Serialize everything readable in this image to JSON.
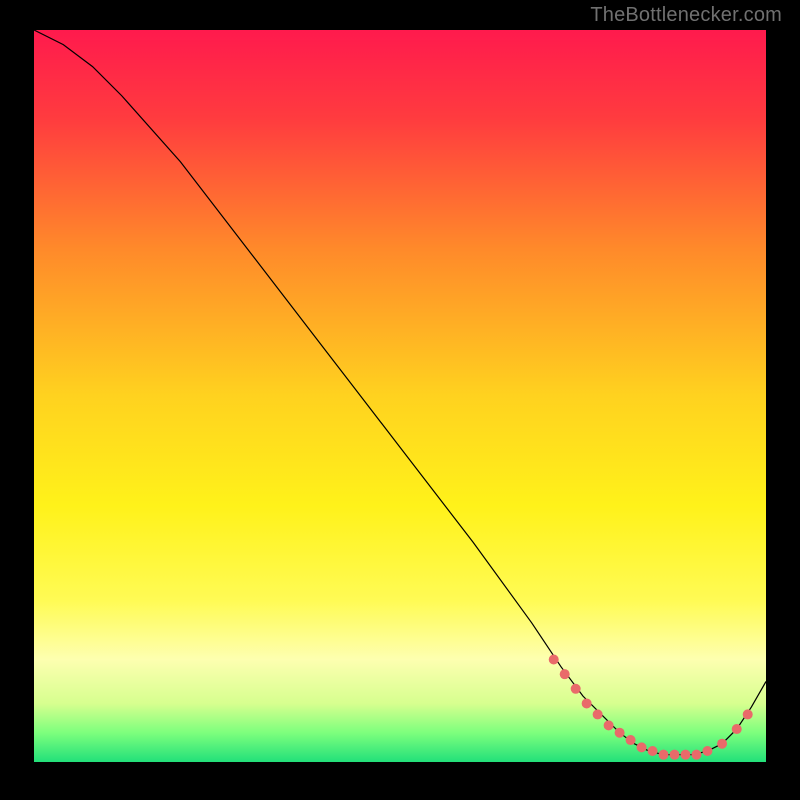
{
  "watermark": "TheBottlenecker.com",
  "chart_data": {
    "type": "line",
    "title": "",
    "xlabel": "",
    "ylabel": "",
    "xlim": [
      0,
      100
    ],
    "ylim": [
      0,
      100
    ],
    "grid": false,
    "background": {
      "type": "vertical-gradient",
      "stops": [
        {
          "pos": 0.0,
          "color": "#ff1a4d"
        },
        {
          "pos": 0.12,
          "color": "#ff3b3f"
        },
        {
          "pos": 0.3,
          "color": "#ff8a2a"
        },
        {
          "pos": 0.5,
          "color": "#ffd21f"
        },
        {
          "pos": 0.65,
          "color": "#fff21a"
        },
        {
          "pos": 0.78,
          "color": "#fffb55"
        },
        {
          "pos": 0.86,
          "color": "#fdffb0"
        },
        {
          "pos": 0.92,
          "color": "#d7ff8f"
        },
        {
          "pos": 0.96,
          "color": "#7dff7d"
        },
        {
          "pos": 1.0,
          "color": "#22e07a"
        }
      ]
    },
    "series": [
      {
        "name": "bottleneck-curve",
        "color": "#000000",
        "width": 1.2,
        "x": [
          0,
          4,
          8,
          12,
          20,
          30,
          40,
          50,
          60,
          68,
          72,
          75,
          78,
          80,
          82,
          84,
          86,
          88,
          90,
          92,
          94,
          96,
          98,
          100
        ],
        "y": [
          100,
          98,
          95,
          91,
          82,
          69,
          56,
          43,
          30,
          19,
          13,
          9,
          6,
          4,
          2.5,
          1.5,
          1,
          1,
          1,
          1.5,
          2.5,
          4.5,
          7.5,
          11
        ]
      }
    ],
    "markers": {
      "name": "highlight-dots",
      "color": "#e96a6a",
      "radius": 5,
      "points": [
        {
          "x": 71,
          "y": 14
        },
        {
          "x": 72.5,
          "y": 12
        },
        {
          "x": 74,
          "y": 10
        },
        {
          "x": 75.5,
          "y": 8
        },
        {
          "x": 77,
          "y": 6.5
        },
        {
          "x": 78.5,
          "y": 5
        },
        {
          "x": 80,
          "y": 4
        },
        {
          "x": 81.5,
          "y": 3
        },
        {
          "x": 83,
          "y": 2
        },
        {
          "x": 84.5,
          "y": 1.5
        },
        {
          "x": 86,
          "y": 1
        },
        {
          "x": 87.5,
          "y": 1
        },
        {
          "x": 89,
          "y": 1
        },
        {
          "x": 90.5,
          "y": 1
        },
        {
          "x": 92,
          "y": 1.5
        },
        {
          "x": 94,
          "y": 2.5
        },
        {
          "x": 96,
          "y": 4.5
        },
        {
          "x": 97.5,
          "y": 6.5
        }
      ]
    }
  }
}
